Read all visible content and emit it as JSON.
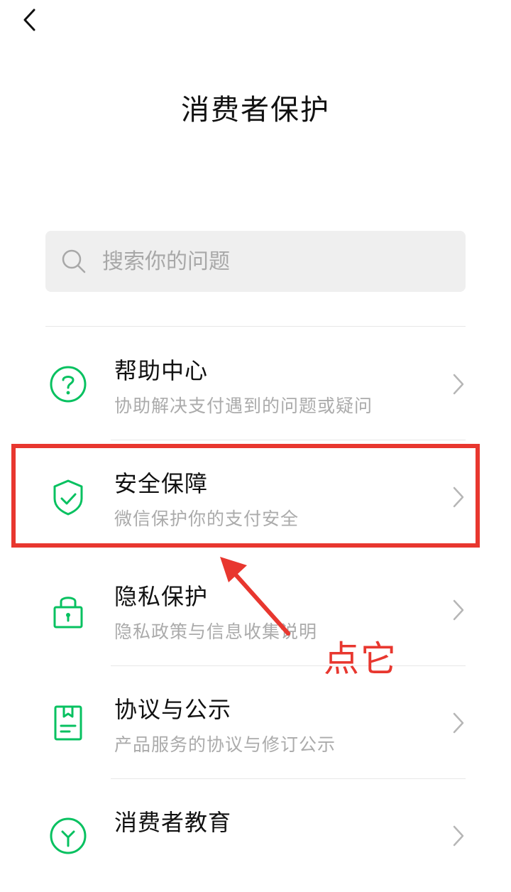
{
  "header": {
    "back_icon": "chevron-left-icon",
    "title": "消费者保护"
  },
  "search": {
    "icon": "search-icon",
    "placeholder": "搜索你的问题"
  },
  "colors": {
    "accent_green": "#07c160",
    "highlight_red": "#e8372f",
    "subtitle_gray": "#ababab",
    "search_bg": "#efefef"
  },
  "menu": [
    {
      "icon": "question-circle-icon",
      "title": "帮助中心",
      "subtitle": "协助解决支付遇到的问题或疑问"
    },
    {
      "icon": "shield-check-icon",
      "title": "安全保障",
      "subtitle": "微信保护你的支付安全"
    },
    {
      "icon": "lock-icon",
      "title": "隐私保护",
      "subtitle": "隐私政策与信息收集说明"
    },
    {
      "icon": "document-icon",
      "title": "协议与公示",
      "subtitle": "产品服务的协议与修订公示"
    },
    {
      "icon": "education-icon",
      "title": "消费者教育",
      "subtitle": ""
    }
  ],
  "annotation": {
    "text": "点它"
  }
}
